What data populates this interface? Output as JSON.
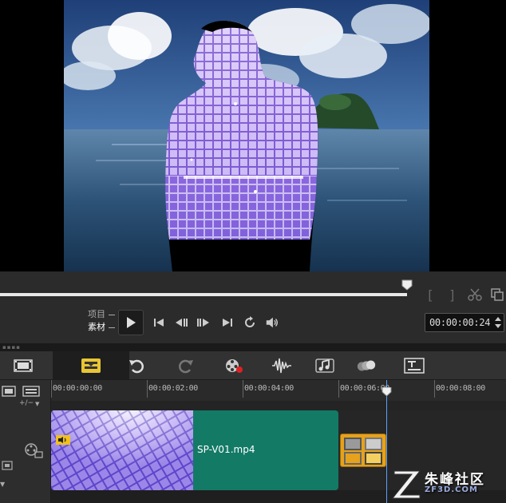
{
  "player": {
    "mode_project": "项目",
    "mode_clip": "素材",
    "bracket_in": "[",
    "bracket_out": "]",
    "timecode": "00:00:00:24"
  },
  "timeline": {
    "ruler_labels": [
      "00:00:00:00",
      "00:00:02:00",
      "00:00:04:00",
      "00:00:06:00",
      "00:00:08:00"
    ],
    "add_remove": "+/−",
    "clip_name": "SP-V01.mp4"
  },
  "watermark": {
    "text": "朱峰社区",
    "url": "ZF3D.COM"
  },
  "colors": {
    "clip": "#137a66",
    "transition": "#e6a21c",
    "playhead": "#5aa0ff",
    "accent_yellow": "#e8c534"
  }
}
